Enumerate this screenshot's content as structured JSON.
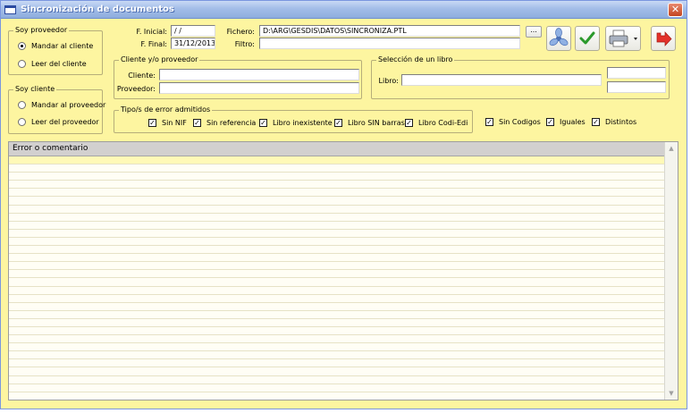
{
  "window": {
    "title": "Sincronización de documentos",
    "close_glyph": "✕"
  },
  "soy_proveedor": {
    "title": "Soy proveedor",
    "option1": "Mandar al cliente",
    "option2": "Leer del cliente",
    "selected": 1
  },
  "soy_cliente": {
    "title": "Soy cliente",
    "option1": "Mandar al proveedor",
    "option2": "Leer del proveedor",
    "selected": 0
  },
  "dates": {
    "inicial_label": "F. Inicial:",
    "inicial_value": " /  /",
    "final_label": "F. Final:",
    "final_value": "31/12/2013"
  },
  "fichero": {
    "label": "Fichero:",
    "value": "D:\\ARG\\GESDIS\\DATOS\\SINCRONIZA.PTL",
    "browse": "..."
  },
  "filtro": {
    "label": "Filtro:",
    "value": ""
  },
  "toolbar": {
    "icon1": "fan-icon",
    "icon2": "check-icon",
    "icon3": "printer-icon",
    "icon4": "exit-arrow-icon"
  },
  "cliente_proveedor": {
    "title": "Cliente y/o proveedor",
    "cliente_label": "Cliente:",
    "cliente_value": "",
    "proveedor_label": "Proveedor:",
    "proveedor_value": ""
  },
  "libro": {
    "title": "Selección de un libro",
    "label": "Libro:",
    "value": ""
  },
  "errores": {
    "title": "Tipo/s de error admitidos",
    "items": [
      {
        "label": "Sin NIF",
        "checked": true
      },
      {
        "label": "Sin referencia",
        "checked": true
      },
      {
        "label": "Libro inexistente",
        "checked": true
      },
      {
        "label": "Libro SIN barras",
        "checked": true
      },
      {
        "label": "Libro Codi-Edi",
        "checked": true
      }
    ],
    "extra": [
      {
        "label": "Sin Codigos",
        "checked": true
      },
      {
        "label": "Iguales",
        "checked": true
      },
      {
        "label": "Distintos",
        "checked": true
      }
    ]
  },
  "grid": {
    "header": "Error o comentario"
  },
  "colors": {
    "background": "#fdf5a0",
    "titlebar": "#a3bde8",
    "selected_row": "#fff9b7"
  }
}
